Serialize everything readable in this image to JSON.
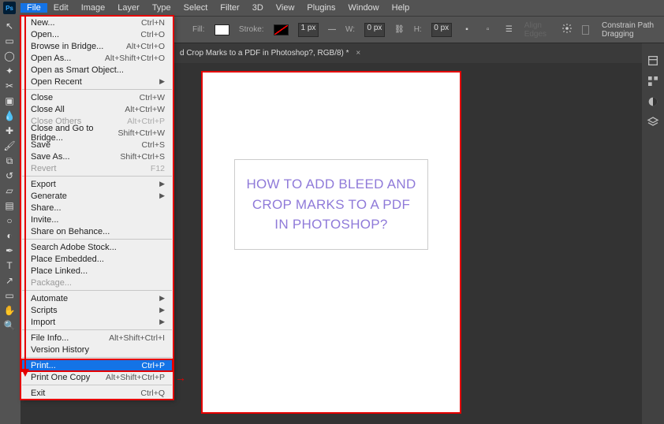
{
  "menubar": {
    "app": "Ps",
    "items": [
      "File",
      "Edit",
      "Image",
      "Layer",
      "Type",
      "Select",
      "Filter",
      "3D",
      "View",
      "Plugins",
      "Window",
      "Help"
    ],
    "active_index": 0
  },
  "options_bar": {
    "fill_label": "Fill:",
    "stroke_label": "Stroke:",
    "stroke_value": "1 px",
    "w_label": "W:",
    "w_value": "0 px",
    "link_icon": "link-icon",
    "h_label": "H:",
    "h_value": "0 px",
    "align_label": "Align Edges",
    "constrain_label": "Constrain Path Dragging"
  },
  "doc_tab": {
    "title": "d Crop Marks to a PDF in Photoshop?, RGB/8) *"
  },
  "canvas": {
    "headline": "HOW TO ADD BLEED AND CROP MARKS TO A PDF IN PHOTOSHOP?"
  },
  "file_menu": {
    "groups": [
      [
        {
          "label": "New...",
          "shortcut": "Ctrl+N",
          "sub": false,
          "disabled": false
        },
        {
          "label": "Open...",
          "shortcut": "Ctrl+O",
          "sub": false,
          "disabled": false
        },
        {
          "label": "Browse in Bridge...",
          "shortcut": "Alt+Ctrl+O",
          "sub": false,
          "disabled": false
        },
        {
          "label": "Open As...",
          "shortcut": "Alt+Shift+Ctrl+O",
          "sub": false,
          "disabled": false
        },
        {
          "label": "Open as Smart Object...",
          "shortcut": "",
          "sub": false,
          "disabled": false
        },
        {
          "label": "Open Recent",
          "shortcut": "",
          "sub": true,
          "disabled": false
        }
      ],
      [
        {
          "label": "Close",
          "shortcut": "Ctrl+W",
          "sub": false,
          "disabled": false
        },
        {
          "label": "Close All",
          "shortcut": "Alt+Ctrl+W",
          "sub": false,
          "disabled": false
        },
        {
          "label": "Close Others",
          "shortcut": "Alt+Ctrl+P",
          "sub": false,
          "disabled": true
        },
        {
          "label": "Close and Go to Bridge...",
          "shortcut": "Shift+Ctrl+W",
          "sub": false,
          "disabled": false
        },
        {
          "label": "Save",
          "shortcut": "Ctrl+S",
          "sub": false,
          "disabled": false
        },
        {
          "label": "Save As...",
          "shortcut": "Shift+Ctrl+S",
          "sub": false,
          "disabled": false
        },
        {
          "label": "Revert",
          "shortcut": "F12",
          "sub": false,
          "disabled": true
        }
      ],
      [
        {
          "label": "Export",
          "shortcut": "",
          "sub": true,
          "disabled": false
        },
        {
          "label": "Generate",
          "shortcut": "",
          "sub": true,
          "disabled": false
        },
        {
          "label": "Share...",
          "shortcut": "",
          "sub": false,
          "disabled": false
        },
        {
          "label": "Invite...",
          "shortcut": "",
          "sub": false,
          "disabled": false
        },
        {
          "label": "Share on Behance...",
          "shortcut": "",
          "sub": false,
          "disabled": false
        }
      ],
      [
        {
          "label": "Search Adobe Stock...",
          "shortcut": "",
          "sub": false,
          "disabled": false
        },
        {
          "label": "Place Embedded...",
          "shortcut": "",
          "sub": false,
          "disabled": false
        },
        {
          "label": "Place Linked...",
          "shortcut": "",
          "sub": false,
          "disabled": false
        },
        {
          "label": "Package...",
          "shortcut": "",
          "sub": false,
          "disabled": true
        }
      ],
      [
        {
          "label": "Automate",
          "shortcut": "",
          "sub": true,
          "disabled": false
        },
        {
          "label": "Scripts",
          "shortcut": "",
          "sub": true,
          "disabled": false
        },
        {
          "label": "Import",
          "shortcut": "",
          "sub": true,
          "disabled": false
        }
      ],
      [
        {
          "label": "File Info...",
          "shortcut": "Alt+Shift+Ctrl+I",
          "sub": false,
          "disabled": false
        },
        {
          "label": "Version History",
          "shortcut": "",
          "sub": false,
          "disabled": false
        }
      ],
      [
        {
          "label": "Print...",
          "shortcut": "Ctrl+P",
          "sub": false,
          "disabled": false,
          "highlighted": true
        },
        {
          "label": "Print One Copy",
          "shortcut": "Alt+Shift+Ctrl+P",
          "sub": false,
          "disabled": false
        }
      ],
      [
        {
          "label": "Exit",
          "shortcut": "Ctrl+Q",
          "sub": false,
          "disabled": false
        }
      ]
    ]
  },
  "tools": [
    "move",
    "marquee",
    "lasso",
    "wand",
    "crop",
    "frame",
    "eyedrop",
    "heal",
    "brush",
    "stamp",
    "history",
    "eraser",
    "gradient",
    "blur",
    "dodge",
    "pen",
    "type",
    "path",
    "rect",
    "hand",
    "zoom"
  ]
}
